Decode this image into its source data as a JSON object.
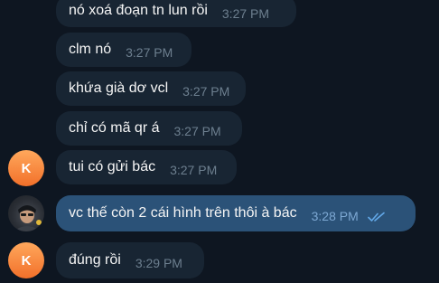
{
  "colors": {
    "background": "#0e1621",
    "incoming_bubble": "#182533",
    "outgoing_bubble": "#2b5278",
    "avatar_accent": "#f2702a",
    "read_check": "#62a8e8"
  },
  "messages": [
    {
      "text": "nó xoá đoạn tn lun rồi",
      "time": "3:27 PM"
    },
    {
      "text": "clm nó",
      "time": "3:27 PM"
    },
    {
      "text": "khứa già dơ vcl",
      "time": "3:27 PM"
    },
    {
      "text": "chỉ có mã qr á",
      "time": "3:27 PM"
    },
    {
      "text": "tui có gửi bác",
      "time": "3:27 PM",
      "avatar": "K"
    },
    {
      "text": "vc thế còn 2 cái hình trên thôi à bác",
      "time": "3:28 PM",
      "avatar_icon": "user-photo-avatar",
      "status_icon": "double-check-icon"
    },
    {
      "text": "đúng rồi",
      "time": "3:29 PM",
      "avatar": "K"
    }
  ]
}
